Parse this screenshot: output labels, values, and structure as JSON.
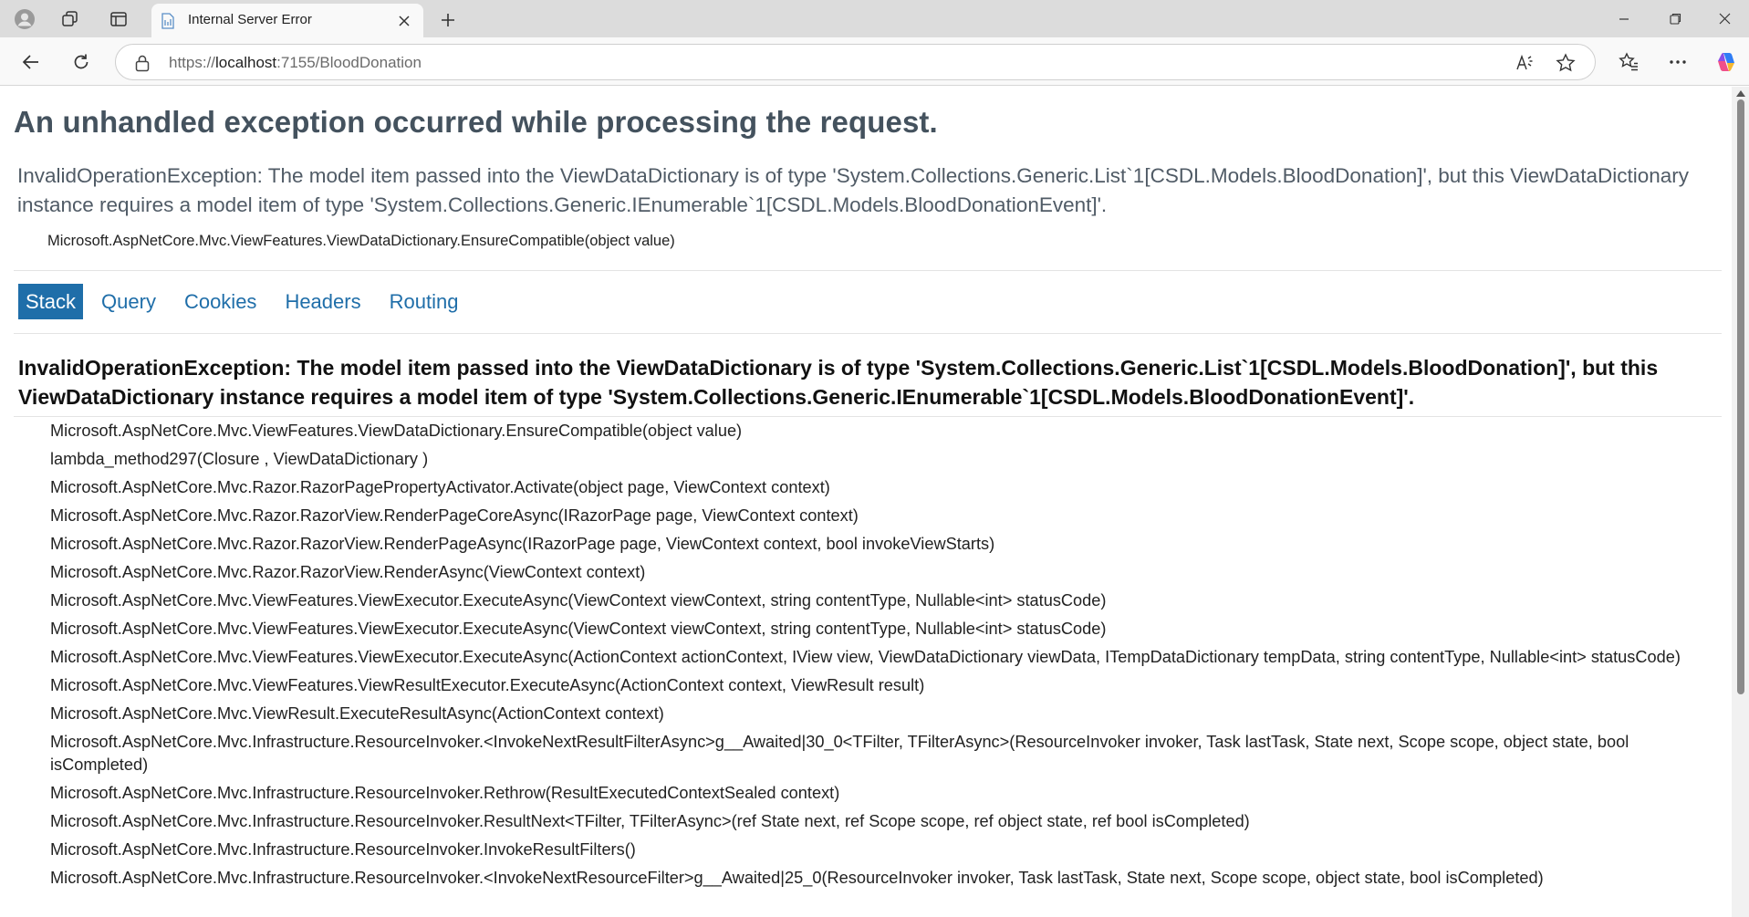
{
  "browser": {
    "tab_title": "Internal Server Error",
    "url_scheme": "https://",
    "url_host": "localhost",
    "url_rest": ":7155/BloodDonation",
    "accent_color": "#1f6ea9"
  },
  "page": {
    "title": "An unhandled exception occurred while processing the request.",
    "summary": "InvalidOperationException: The model item passed into the ViewDataDictionary is of type 'System.Collections.Generic.List`1[CSDL.Models.BloodDonation]', but this ViewDataDictionary instance requires a model item of type 'System.Collections.Generic.IEnumerable`1[CSDL.Models.BloodDonationEvent]'.",
    "location": "Microsoft.AspNetCore.Mvc.ViewFeatures.ViewDataDictionary.EnsureCompatible(object value)",
    "tabs": [
      "Stack",
      "Query",
      "Cookies",
      "Headers",
      "Routing"
    ],
    "active_tab": "Stack",
    "stack_heading": "InvalidOperationException: The model item passed into the ViewDataDictionary is of type 'System.Collections.Generic.List`1[CSDL.Models.BloodDonation]', but this ViewDataDictionary instance requires a model item of type 'System.Collections.Generic.IEnumerable`1[CSDL.Models.BloodDonationEvent]'.",
    "frames": [
      "Microsoft.AspNetCore.Mvc.ViewFeatures.ViewDataDictionary.EnsureCompatible(object value)",
      "lambda_method297(Closure , ViewDataDictionary )",
      "Microsoft.AspNetCore.Mvc.Razor.RazorPagePropertyActivator.Activate(object page, ViewContext context)",
      "Microsoft.AspNetCore.Mvc.Razor.RazorView.RenderPageCoreAsync(IRazorPage page, ViewContext context)",
      "Microsoft.AspNetCore.Mvc.Razor.RazorView.RenderPageAsync(IRazorPage page, ViewContext context, bool invokeViewStarts)",
      "Microsoft.AspNetCore.Mvc.Razor.RazorView.RenderAsync(ViewContext context)",
      "Microsoft.AspNetCore.Mvc.ViewFeatures.ViewExecutor.ExecuteAsync(ViewContext viewContext, string contentType, Nullable<int> statusCode)",
      "Microsoft.AspNetCore.Mvc.ViewFeatures.ViewExecutor.ExecuteAsync(ViewContext viewContext, string contentType, Nullable<int> statusCode)",
      "Microsoft.AspNetCore.Mvc.ViewFeatures.ViewExecutor.ExecuteAsync(ActionContext actionContext, IView view, ViewDataDictionary viewData, ITempDataDictionary tempData, string contentType, Nullable<int> statusCode)",
      "Microsoft.AspNetCore.Mvc.ViewFeatures.ViewResultExecutor.ExecuteAsync(ActionContext context, ViewResult result)",
      "Microsoft.AspNetCore.Mvc.ViewResult.ExecuteResultAsync(ActionContext context)",
      "Microsoft.AspNetCore.Mvc.Infrastructure.ResourceInvoker.<InvokeNextResultFilterAsync>g__Awaited|30_0<TFilter, TFilterAsync>(ResourceInvoker invoker, Task lastTask, State next, Scope scope, object state, bool isCompleted)",
      "Microsoft.AspNetCore.Mvc.Infrastructure.ResourceInvoker.Rethrow(ResultExecutedContextSealed context)",
      "Microsoft.AspNetCore.Mvc.Infrastructure.ResourceInvoker.ResultNext<TFilter, TFilterAsync>(ref State next, ref Scope scope, ref object state, ref bool isCompleted)",
      "Microsoft.AspNetCore.Mvc.Infrastructure.ResourceInvoker.InvokeResultFilters()",
      "Microsoft.AspNetCore.Mvc.Infrastructure.ResourceInvoker.<InvokeNextResourceFilter>g__Awaited|25_0(ResourceInvoker invoker, Task lastTask, State next, Scope scope, object state, bool isCompleted)"
    ]
  }
}
